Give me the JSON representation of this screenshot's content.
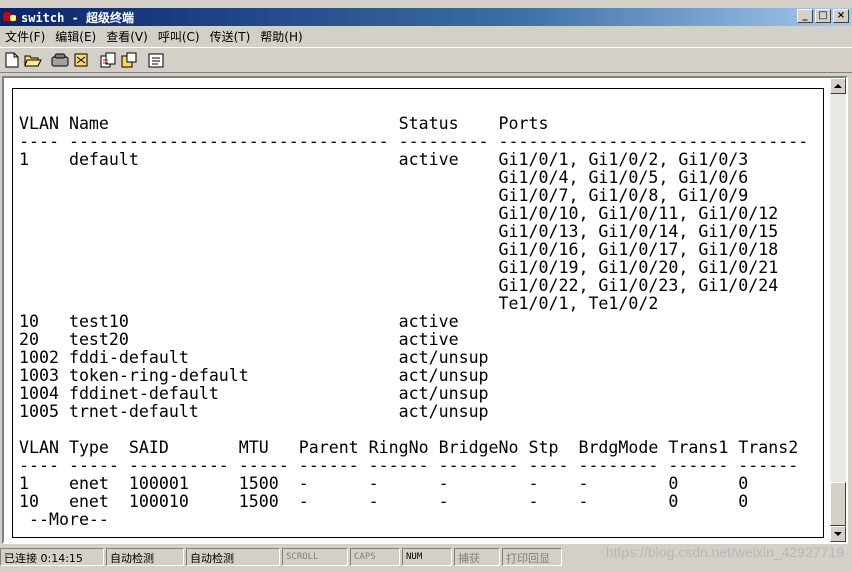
{
  "window": {
    "title": "switch - 超级终端",
    "minimize": "_",
    "maximize": "□",
    "close": "×"
  },
  "menu": [
    "文件(F)",
    "编辑(E)",
    "查看(V)",
    "呼叫(C)",
    "传送(T)",
    "帮助(H)"
  ],
  "toolbar": {
    "icons": [
      "new-icon",
      "open-icon",
      "phone-icon",
      "disconnect-icon",
      "send-icon",
      "receive-icon",
      "properties-icon"
    ]
  },
  "terminal": {
    "lines": [
      "VLAN Name                             Status    Ports",
      "---- -------------------------------- --------- -------------------------------",
      "1    default                          active    Gi1/0/1, Gi1/0/2, Gi1/0/3",
      "                                                Gi1/0/4, Gi1/0/5, Gi1/0/6",
      "                                                Gi1/0/7, Gi1/0/8, Gi1/0/9",
      "                                                Gi1/0/10, Gi1/0/11, Gi1/0/12",
      "                                                Gi1/0/13, Gi1/0/14, Gi1/0/15",
      "                                                Gi1/0/16, Gi1/0/17, Gi1/0/18",
      "                                                Gi1/0/19, Gi1/0/20, Gi1/0/21",
      "                                                Gi1/0/22, Gi1/0/23, Gi1/0/24",
      "                                                Te1/0/1, Te1/0/2",
      "10   test10                           active",
      "20   test20                           active",
      "1002 fddi-default                     act/unsup",
      "1003 token-ring-default               act/unsup",
      "1004 fddinet-default                  act/unsup",
      "1005 trnet-default                    act/unsup",
      "",
      "VLAN Type  SAID       MTU   Parent RingNo BridgeNo Stp  BrdgMode Trans1 Trans2",
      "---- ----- ---------- ----- ------ ------ -------- ---- -------- ------ ------",
      "1    enet  100001     1500  -      -      -        -    -        0      0",
      "10   enet  100010     1500  -      -      -        -    -        0      0",
      " --More--"
    ]
  },
  "status": {
    "connected": "已连接 0:14:15",
    "detect1": "自动检测",
    "detect2": "自动检测",
    "scroll": "SCROLL",
    "caps": "CAPS",
    "num": "NUM",
    "capture": "捕获",
    "echo": "打印回显"
  },
  "watermark": "https://blog.csdn.net/weixin_42927719"
}
